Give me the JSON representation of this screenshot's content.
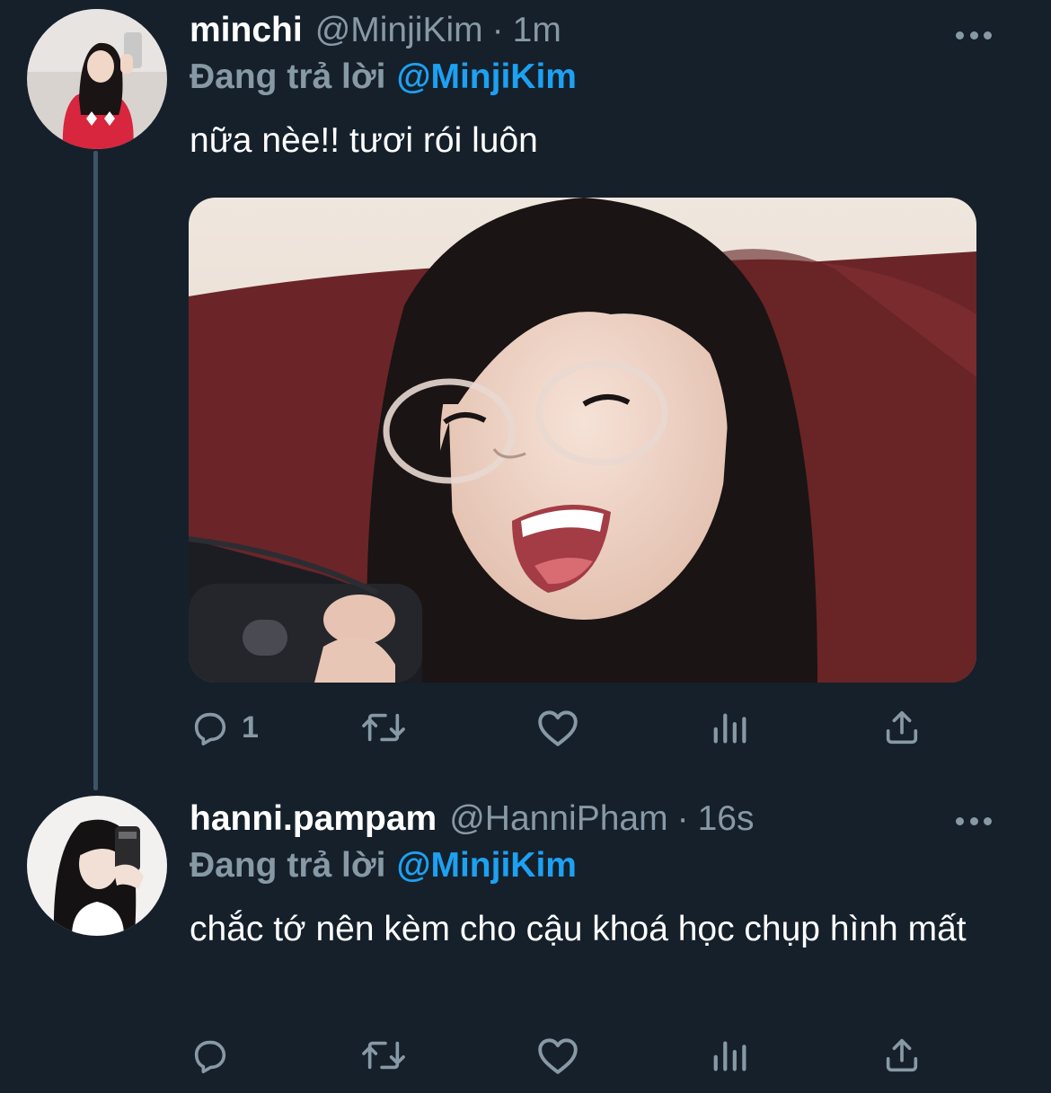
{
  "colors": {
    "background": "#15202b",
    "secondary_text": "#8899a6",
    "accent": "#1da1f2",
    "thread_line": "#3d5466"
  },
  "tweets": [
    {
      "display_name": "minchi",
      "handle": "@MinjiKim",
      "separator": "·",
      "time": "1m",
      "reply_prefix": "Đang trả lời",
      "reply_to": "@MinjiKim",
      "text": "nữa nèe!! tươi rói luôn",
      "has_media": true,
      "actions": {
        "reply_icon": "reply-icon",
        "reply_count": "1",
        "retweet_icon": "retweet-icon",
        "like_icon": "heart-icon",
        "stats_icon": "stats-icon",
        "share_icon": "share-icon"
      }
    },
    {
      "display_name": "hanni.pampam",
      "handle": "@HanniPham",
      "separator": "·",
      "time": "16s",
      "reply_prefix": "Đang trả lời",
      "reply_to": "@MinjiKim",
      "text": "chắc tớ nên kèm cho cậu khoá học chụp hình mất",
      "has_media": false,
      "actions": {
        "reply_icon": "reply-icon",
        "reply_count": "",
        "retweet_icon": "retweet-icon",
        "like_icon": "heart-icon",
        "stats_icon": "stats-icon",
        "share_icon": "share-icon"
      }
    }
  ]
}
